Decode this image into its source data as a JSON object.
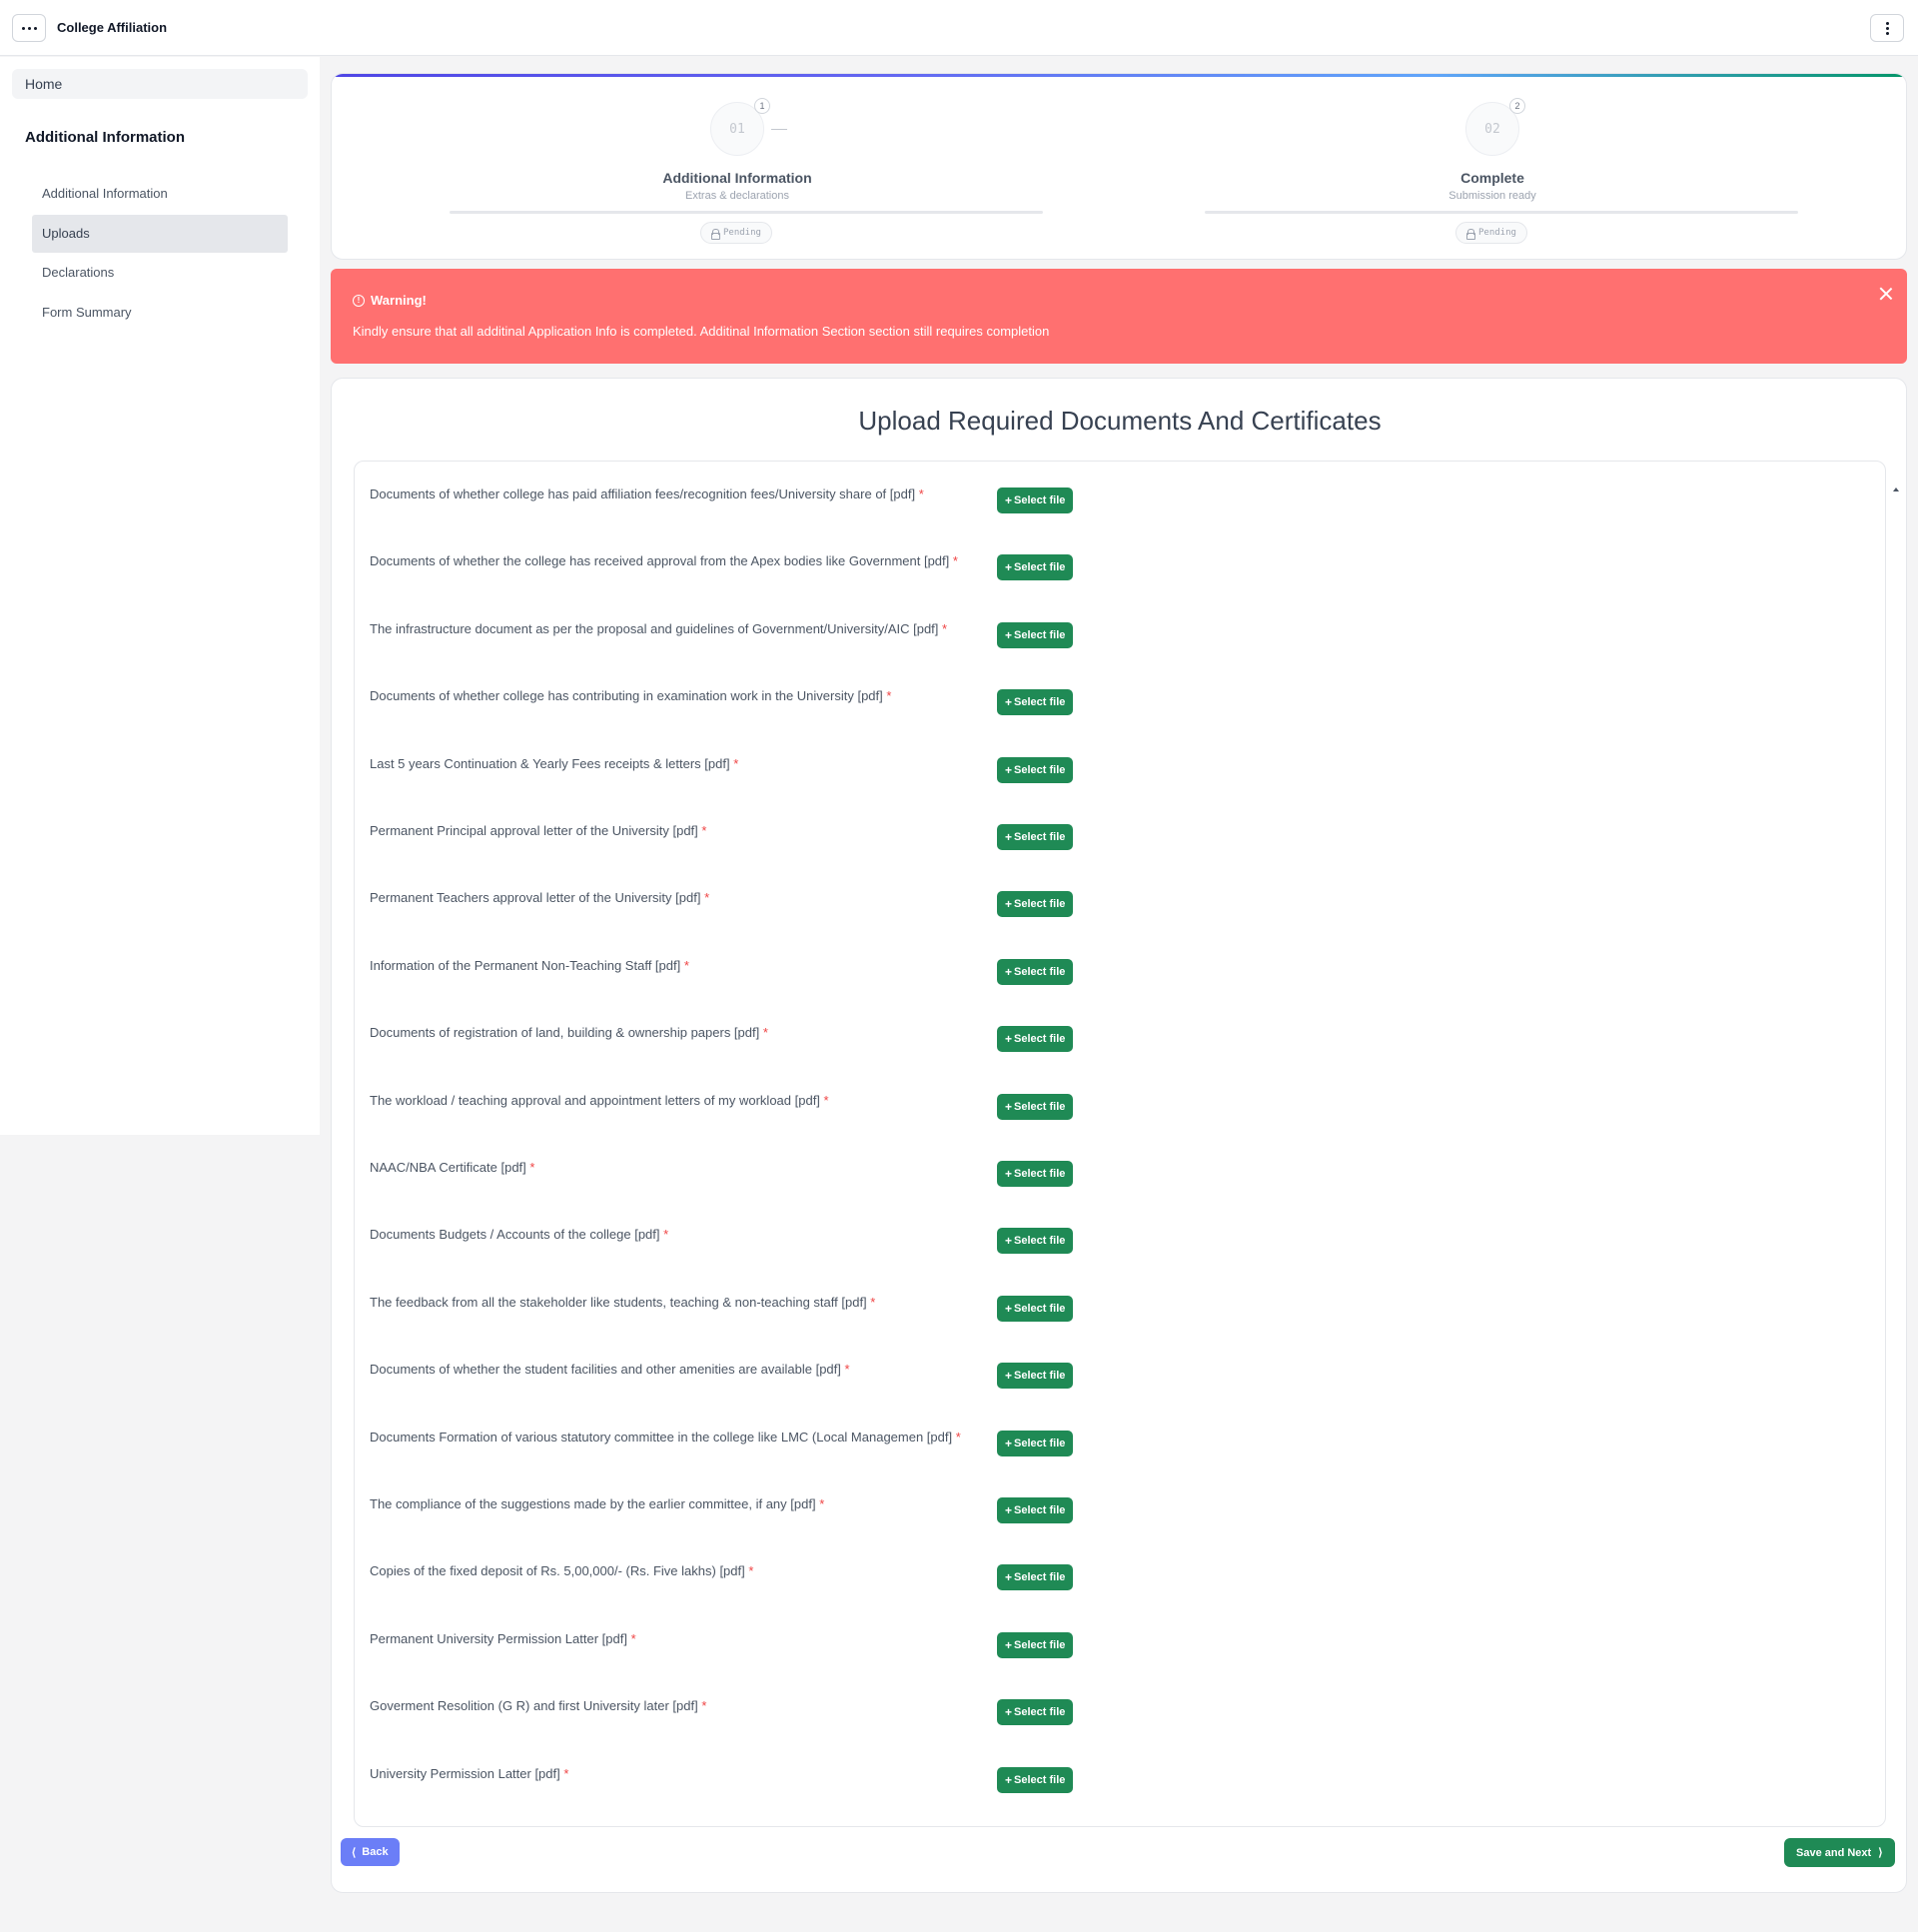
{
  "app": {
    "title": "College Affiliation"
  },
  "sidebar": {
    "home_label": "Home",
    "section_heading": "Additional Information",
    "items": [
      {
        "label": "Additional Information",
        "active": false
      },
      {
        "label": "Uploads",
        "active": true
      },
      {
        "label": "Declarations",
        "active": false
      },
      {
        "label": "Form Summary",
        "active": false
      }
    ]
  },
  "stepper": {
    "steps": [
      {
        "number": "01",
        "badge": "1",
        "title": "Additional Information",
        "subtitle": "Extras & declarations",
        "status": "Pending"
      },
      {
        "number": "02",
        "badge": "2",
        "title": "Complete",
        "subtitle": "Submission ready",
        "status": "Pending"
      }
    ]
  },
  "warning": {
    "title": "Warning!",
    "message": "Kindly ensure that all additinal Application Info is completed. Additinal Information Section section still requires completion"
  },
  "uploads": {
    "title": "Upload Required Documents And Certificates",
    "required_marker": "*",
    "select_label": "Select file",
    "documents": [
      "Documents of whether college has paid affiliation fees/recognition fees/University share of [pdf]",
      "Documents of whether the college has received approval from the Apex bodies like Government [pdf]",
      "The infrastructure document as per the proposal and guidelines of Government/University/AIC [pdf]",
      "Documents of whether college has contributing in examination work in the University [pdf]",
      "Last 5 years Continuation & Yearly Fees receipts & letters [pdf]",
      "Permanent Principal approval letter of the University [pdf]",
      "Permanent Teachers approval letter of the University [pdf]",
      "Information of the Permanent Non-Teaching Staff [pdf]",
      "Documents of registration of land, building & ownership papers [pdf]",
      "The workload / teaching approval and appointment letters of my workload [pdf]",
      "NAAC/NBA Certificate [pdf]",
      "Documents Budgets / Accounts of the college [pdf]",
      "The feedback from all the stakeholder like students, teaching & non-teaching staff [pdf]",
      "Documents of whether the student facilities and other amenities are available [pdf]",
      "Documents Formation of various statutory committee in the college like LMC (Local Managemen [pdf]",
      "The compliance of the suggestions made by the earlier committee, if any [pdf]",
      "Copies of the fixed deposit of Rs. 5,00,000/- (Rs. Five lakhs) [pdf]",
      "Permanent University Permission Latter [pdf]",
      "Goverment Resolition (G R) and first University later [pdf]",
      "University Permission Latter [pdf]"
    ]
  },
  "footer": {
    "back_label": "Back",
    "next_label": "Save and Next"
  },
  "colors": {
    "accent_green": "#1f8a55",
    "back_blue": "#6b7ef7",
    "warning_red": "#ff7070"
  },
  "icons": {
    "menu": "horizontal-dots-icon",
    "kebab": "vertical-dots-icon",
    "lock": "lock-icon",
    "info": "info-circle-icon",
    "close": "close-icon",
    "plus": "plus-icon",
    "back": "chevron-left-icon",
    "next": "chevron-right-icon"
  }
}
